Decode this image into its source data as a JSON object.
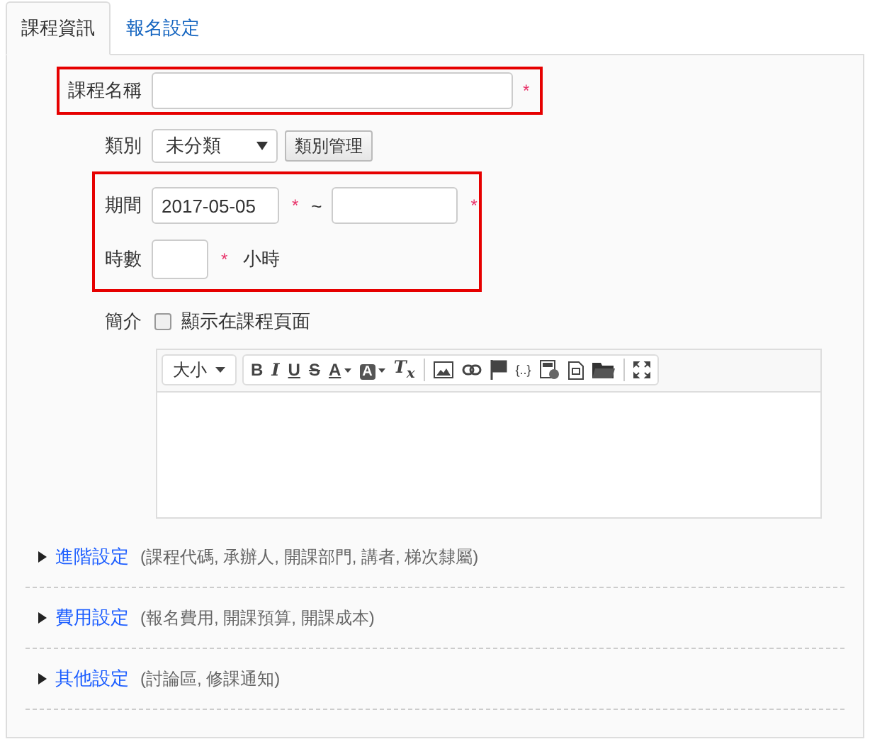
{
  "tabs": [
    {
      "label": "課程資訊",
      "selected": true
    },
    {
      "label": "報名設定",
      "selected": false
    }
  ],
  "course_name": {
    "label": "課程名稱",
    "required_mark": "*",
    "highlighted": true
  },
  "category": {
    "label": "類別",
    "value": "未分類",
    "button": "類別管理"
  },
  "schedule": {
    "highlighted": true,
    "period": {
      "label": "期間",
      "start": "2017-05-05",
      "start_mark": "*",
      "separator": "~",
      "end_mark": "*"
    },
    "hours": {
      "label": "時數",
      "mark": "*",
      "unit": "小時"
    }
  },
  "intro": {
    "label": "簡介",
    "show_on_page": {
      "label": "顯示在課程頁面",
      "checked": false
    },
    "size_menu": "大小",
    "toolbar": [
      {
        "kind": "bold",
        "label": "B"
      },
      {
        "kind": "italic",
        "label": "I"
      },
      {
        "kind": "underline",
        "label": "U"
      },
      {
        "kind": "strike",
        "label": "S"
      },
      {
        "kind": "textcolor",
        "label": "A"
      },
      {
        "kind": "bgcolor",
        "label": "A"
      },
      {
        "kind": "clear",
        "label": "T$_{x}$"
      },
      {
        "kind": "separator"
      },
      {
        "kind": "image"
      },
      {
        "kind": "link"
      },
      {
        "kind": "flag"
      },
      {
        "kind": "code",
        "label": "{..}"
      },
      {
        "kind": "save"
      },
      {
        "kind": "template"
      },
      {
        "kind": "folder"
      },
      {
        "kind": "separator"
      },
      {
        "kind": "maximize"
      }
    ]
  },
  "sections": [
    {
      "title": "進階設定",
      "hint": "(課程代碼, 承辦人, 開課部門, 講者, 梯次隸屬)",
      "expanded": false
    },
    {
      "title": "費用設定",
      "hint": "(報名費用, 開課預算, 開課成本)",
      "expanded": false
    },
    {
      "title": "其他設定",
      "hint": "(討論區, 修課通知)",
      "expanded": false
    }
  ]
}
